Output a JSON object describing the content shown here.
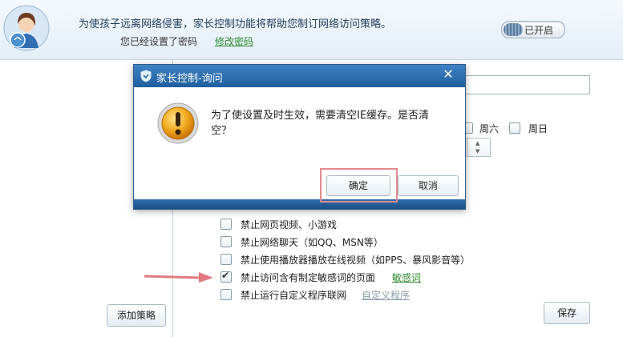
{
  "header": {
    "line1": "为使孩子远离网络侵害，家长控制功能将帮助您制订网络访问策略。",
    "line2": "您已经设置了密码",
    "change_password": "修改密码",
    "toggle_label": "已开启"
  },
  "left": {
    "add_policy": "添加策略"
  },
  "right": {
    "days": [
      "周六",
      "周日"
    ],
    "rules": [
      {
        "label": "禁止网页视频、小游戏",
        "checked": false
      },
      {
        "label": "禁止网络聊天（如QQ、MSN等）",
        "checked": false
      },
      {
        "label": "禁止使用播放器播放在线视频（如PPS、暴风影音等）",
        "checked": false
      },
      {
        "label": "禁止访问含有制定敏感词的页面",
        "checked": true,
        "link": "敏感词"
      },
      {
        "label": "禁止运行自定义程序联网",
        "checked": false,
        "link": "自定义程序"
      }
    ],
    "save": "保存"
  },
  "dialog": {
    "title": "家长控制-询问",
    "close": "✕",
    "message_line1": "为了使设置及时生效，需要清空IE缓存。是否清",
    "message_line2": "空？",
    "ok": "确定",
    "cancel": "取消"
  },
  "colors": {
    "accent": "#2766a8",
    "link_green": "#2e8b2e",
    "link_gray": "#8a9aaa",
    "highlight": "#e4898e",
    "arrow": "#e07a80"
  }
}
